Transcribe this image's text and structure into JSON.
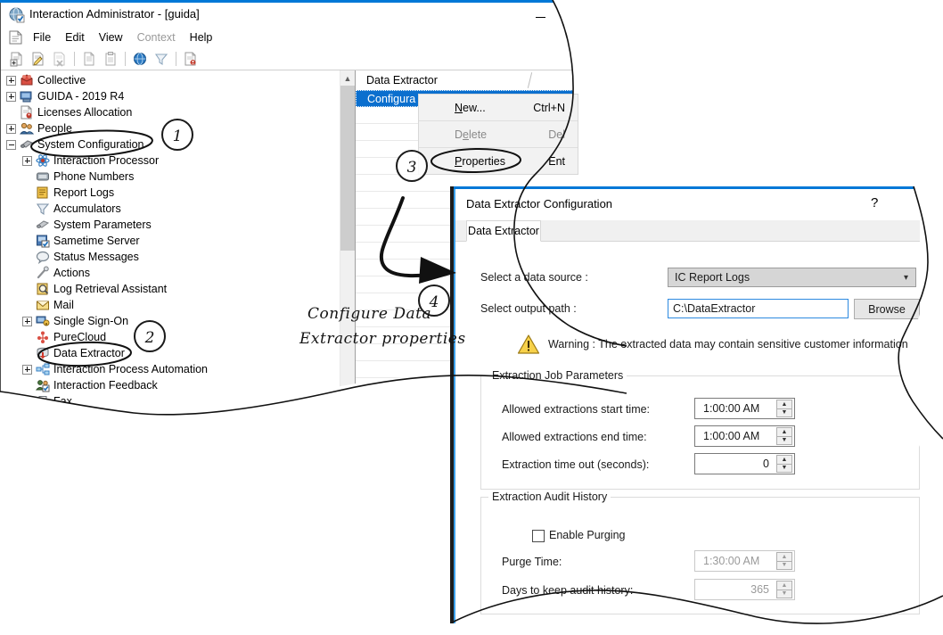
{
  "app": {
    "title": "Interaction Administrator - [guida]",
    "title_icon": "globe-check-icon",
    "window_controls": {
      "minimize": "minimize-icon",
      "maximize": "maximize-icon"
    },
    "mdi_controls": {
      "restore": "mdi-restore-icon",
      "restore_small": "mdi-restore-small-icon"
    }
  },
  "menubar": {
    "doc_icon": "document-icon",
    "items": [
      {
        "label": "File",
        "disabled": false
      },
      {
        "label": "Edit",
        "disabled": false
      },
      {
        "label": "View",
        "disabled": false
      },
      {
        "label": "Context",
        "disabled": true
      },
      {
        "label": "Help",
        "disabled": false
      }
    ]
  },
  "toolbar": {
    "buttons": [
      {
        "name": "new-icon"
      },
      {
        "name": "edit-icon"
      },
      {
        "name": "delete-icon"
      },
      {
        "name": "copy-icon"
      },
      {
        "name": "paste-icon"
      },
      {
        "name": "search-globe-icon"
      },
      {
        "name": "accumulators-icon"
      },
      {
        "name": "licenses-icon"
      }
    ]
  },
  "tree": {
    "items": [
      {
        "label": "Collective",
        "indent": 0,
        "expander": "plus",
        "icon": "collective-icon"
      },
      {
        "label": "GUIDA - 2019 R4",
        "indent": 0,
        "expander": "plus",
        "icon": "server-icon"
      },
      {
        "label": "Licenses Allocation",
        "indent": 0,
        "expander": "none",
        "icon": "licenses-icon"
      },
      {
        "label": "People",
        "indent": 0,
        "expander": "plus",
        "icon": "people-icon"
      },
      {
        "label": "System Configuration",
        "indent": 0,
        "expander": "minus",
        "icon": "config-icon"
      },
      {
        "label": "Interaction Processor",
        "indent": 1,
        "expander": "plus",
        "icon": "processor-icon"
      },
      {
        "label": "Phone Numbers",
        "indent": 1,
        "expander": "none",
        "icon": "phone-icon"
      },
      {
        "label": "Report Logs",
        "indent": 1,
        "expander": "none",
        "icon": "reportlogs-icon"
      },
      {
        "label": "Accumulators",
        "indent": 1,
        "expander": "none",
        "icon": "accumulators-icon"
      },
      {
        "label": "System Parameters",
        "indent": 1,
        "expander": "none",
        "icon": "sysparams-icon"
      },
      {
        "label": "Sametime Server",
        "indent": 1,
        "expander": "none",
        "icon": "sametime-icon"
      },
      {
        "label": "Status Messages",
        "indent": 1,
        "expander": "none",
        "icon": "statusmessages-icon"
      },
      {
        "label": "Actions",
        "indent": 1,
        "expander": "none",
        "icon": "actions-icon"
      },
      {
        "label": "Log Retrieval Assistant",
        "indent": 1,
        "expander": "none",
        "icon": "logretrieval-icon"
      },
      {
        "label": "Mail",
        "indent": 1,
        "expander": "none",
        "icon": "mail-icon"
      },
      {
        "label": "Single Sign-On",
        "indent": 1,
        "expander": "plus",
        "icon": "sso-icon"
      },
      {
        "label": "PureCloud",
        "indent": 1,
        "expander": "none",
        "icon": "purecloud-icon"
      },
      {
        "label": "Data Extractor",
        "indent": 1,
        "expander": "none",
        "icon": "dataextractor-icon"
      },
      {
        "label": "Interaction Process Automation",
        "indent": 1,
        "expander": "plus",
        "icon": "ipa-icon"
      },
      {
        "label": "Interaction Feedback",
        "indent": 1,
        "expander": "none",
        "icon": "feedback-icon"
      },
      {
        "label": "Fax",
        "indent": 1,
        "expander": "plus",
        "icon": "fax-icon"
      }
    ]
  },
  "list_panel": {
    "header": "Data Extractor",
    "selected_row": "Configura"
  },
  "context_menu": {
    "items": [
      {
        "label": "New...",
        "accel": "Ctrl+N",
        "disabled": false,
        "underline": "N"
      },
      {
        "label": "Delete",
        "accel": "Del",
        "disabled": true,
        "underline": "e"
      },
      {
        "label": "Properties",
        "accel": "Ent",
        "disabled": false,
        "underline": "P"
      }
    ]
  },
  "dialog": {
    "title": "Data Extractor Configuration",
    "help_glyph": "?",
    "tab": "Data Extractor",
    "fields": {
      "data_source_label": "Select a data source :",
      "data_source_value": "IC Report Logs",
      "output_path_label": "Select output path :",
      "output_path_value": "C:\\DataExtractor",
      "browse_label": "Browse"
    },
    "warning": {
      "icon": "warning-triangle-icon",
      "text": "Warning : The extracted data may contain sensitive customer information."
    },
    "job_group": {
      "title": "Extraction Job Parameters",
      "rows": [
        {
          "label": "Allowed extractions start time:",
          "value": "1:00:00 AM",
          "align": "left",
          "disabled": false
        },
        {
          "label": "Allowed extractions end time:",
          "value": "1:00:00 AM",
          "align": "left",
          "disabled": false
        },
        {
          "label": "Extraction time out (seconds):",
          "value": "0",
          "align": "right",
          "disabled": false
        }
      ]
    },
    "audit_group": {
      "title": "Extraction Audit History",
      "checkbox_label": "Enable Purging",
      "checkbox_checked": false,
      "rows": [
        {
          "label": "Purge Time:",
          "value": "1:30:00 AM",
          "align": "left",
          "disabled": true
        },
        {
          "label": "Days to keep audit history:",
          "value": "365",
          "align": "right",
          "disabled": true
        }
      ]
    }
  },
  "annotations": {
    "callouts": [
      {
        "number": "1"
      },
      {
        "number": "2"
      },
      {
        "number": "3"
      },
      {
        "number": "4"
      }
    ],
    "note_line1": "Configure Data",
    "note_line2": "Extractor properties"
  },
  "colors": {
    "accent_blue": "#0078d7",
    "selection_blue": "#0b6fce",
    "focus_border": "#2d8ae0",
    "warning_yellow": "#f2c531",
    "disabled_text": "#9a9a9a"
  }
}
